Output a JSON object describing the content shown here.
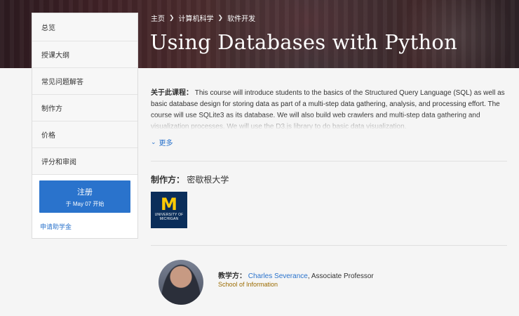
{
  "breadcrumb": {
    "home": "主页",
    "category": "计算机科学",
    "subcategory": "软件开发"
  },
  "course": {
    "title": "Using Databases with Python"
  },
  "sidebar": {
    "items": [
      {
        "label": "总览"
      },
      {
        "label": "授课大纲"
      },
      {
        "label": "常见问题解答"
      },
      {
        "label": "制作方"
      },
      {
        "label": "价格"
      },
      {
        "label": "评分和审阅"
      }
    ],
    "enroll_label": "注册",
    "enroll_sub": "于 May 07 开始",
    "aid_link": "申请助学金"
  },
  "about": {
    "label": "关于此课程：",
    "text": "This course will introduce students to the basics of the Structured Query Language (SQL) as well as basic database design for storing data as part of a multi-step data gathering, analysis, and processing effort.  The course will use SQLite3 as its database.  We will also build web crawlers and multi-step data gathering and visualization processes.  We will use the D3.js library to do basic data visualization.",
    "more_label": "更多"
  },
  "producer": {
    "label": "制作方：",
    "name": "密歇根大学",
    "logo_mark": "M",
    "logo_line1": "UNIVERSITY OF",
    "logo_line2": "MICHIGAN"
  },
  "instructor": {
    "label": "教学方：",
    "name": "Charles Severance",
    "title": ", Associate Professor",
    "school": "School of Information"
  },
  "colors": {
    "accent": "#2a73cc",
    "michigan_blue": "#0b2e5a",
    "michigan_maize": "#ffcb05",
    "school": "#9b6b00"
  }
}
